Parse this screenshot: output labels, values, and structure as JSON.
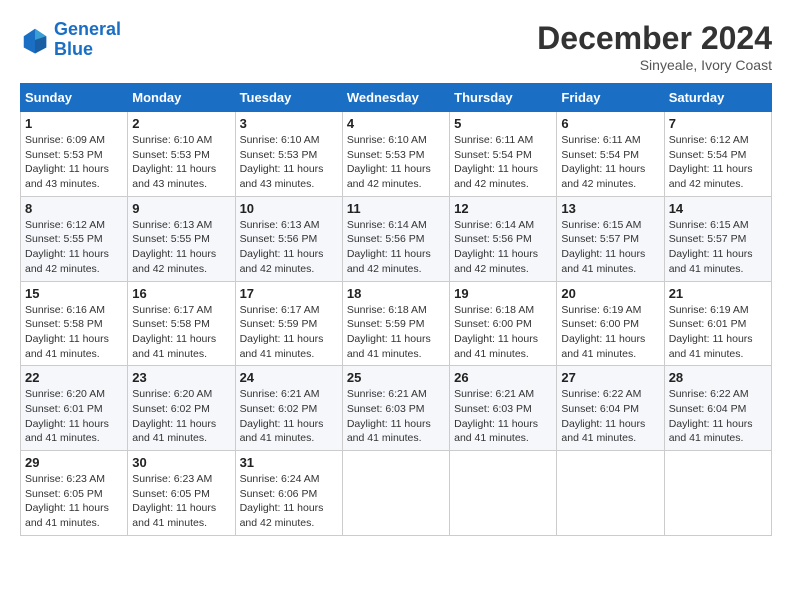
{
  "logo": {
    "line1": "General",
    "line2": "Blue"
  },
  "title": "December 2024",
  "subtitle": "Sinyeale, Ivory Coast",
  "weekdays": [
    "Sunday",
    "Monday",
    "Tuesday",
    "Wednesday",
    "Thursday",
    "Friday",
    "Saturday"
  ],
  "weeks": [
    [
      {
        "day": "1",
        "info": "Sunrise: 6:09 AM\nSunset: 5:53 PM\nDaylight: 11 hours and 43 minutes."
      },
      {
        "day": "2",
        "info": "Sunrise: 6:10 AM\nSunset: 5:53 PM\nDaylight: 11 hours and 43 minutes."
      },
      {
        "day": "3",
        "info": "Sunrise: 6:10 AM\nSunset: 5:53 PM\nDaylight: 11 hours and 43 minutes."
      },
      {
        "day": "4",
        "info": "Sunrise: 6:10 AM\nSunset: 5:53 PM\nDaylight: 11 hours and 42 minutes."
      },
      {
        "day": "5",
        "info": "Sunrise: 6:11 AM\nSunset: 5:54 PM\nDaylight: 11 hours and 42 minutes."
      },
      {
        "day": "6",
        "info": "Sunrise: 6:11 AM\nSunset: 5:54 PM\nDaylight: 11 hours and 42 minutes."
      },
      {
        "day": "7",
        "info": "Sunrise: 6:12 AM\nSunset: 5:54 PM\nDaylight: 11 hours and 42 minutes."
      }
    ],
    [
      {
        "day": "8",
        "info": "Sunrise: 6:12 AM\nSunset: 5:55 PM\nDaylight: 11 hours and 42 minutes."
      },
      {
        "day": "9",
        "info": "Sunrise: 6:13 AM\nSunset: 5:55 PM\nDaylight: 11 hours and 42 minutes."
      },
      {
        "day": "10",
        "info": "Sunrise: 6:13 AM\nSunset: 5:56 PM\nDaylight: 11 hours and 42 minutes."
      },
      {
        "day": "11",
        "info": "Sunrise: 6:14 AM\nSunset: 5:56 PM\nDaylight: 11 hours and 42 minutes."
      },
      {
        "day": "12",
        "info": "Sunrise: 6:14 AM\nSunset: 5:56 PM\nDaylight: 11 hours and 42 minutes."
      },
      {
        "day": "13",
        "info": "Sunrise: 6:15 AM\nSunset: 5:57 PM\nDaylight: 11 hours and 41 minutes."
      },
      {
        "day": "14",
        "info": "Sunrise: 6:15 AM\nSunset: 5:57 PM\nDaylight: 11 hours and 41 minutes."
      }
    ],
    [
      {
        "day": "15",
        "info": "Sunrise: 6:16 AM\nSunset: 5:58 PM\nDaylight: 11 hours and 41 minutes."
      },
      {
        "day": "16",
        "info": "Sunrise: 6:17 AM\nSunset: 5:58 PM\nDaylight: 11 hours and 41 minutes."
      },
      {
        "day": "17",
        "info": "Sunrise: 6:17 AM\nSunset: 5:59 PM\nDaylight: 11 hours and 41 minutes."
      },
      {
        "day": "18",
        "info": "Sunrise: 6:18 AM\nSunset: 5:59 PM\nDaylight: 11 hours and 41 minutes."
      },
      {
        "day": "19",
        "info": "Sunrise: 6:18 AM\nSunset: 6:00 PM\nDaylight: 11 hours and 41 minutes."
      },
      {
        "day": "20",
        "info": "Sunrise: 6:19 AM\nSunset: 6:00 PM\nDaylight: 11 hours and 41 minutes."
      },
      {
        "day": "21",
        "info": "Sunrise: 6:19 AM\nSunset: 6:01 PM\nDaylight: 11 hours and 41 minutes."
      }
    ],
    [
      {
        "day": "22",
        "info": "Sunrise: 6:20 AM\nSunset: 6:01 PM\nDaylight: 11 hours and 41 minutes."
      },
      {
        "day": "23",
        "info": "Sunrise: 6:20 AM\nSunset: 6:02 PM\nDaylight: 11 hours and 41 minutes."
      },
      {
        "day": "24",
        "info": "Sunrise: 6:21 AM\nSunset: 6:02 PM\nDaylight: 11 hours and 41 minutes."
      },
      {
        "day": "25",
        "info": "Sunrise: 6:21 AM\nSunset: 6:03 PM\nDaylight: 11 hours and 41 minutes."
      },
      {
        "day": "26",
        "info": "Sunrise: 6:21 AM\nSunset: 6:03 PM\nDaylight: 11 hours and 41 minutes."
      },
      {
        "day": "27",
        "info": "Sunrise: 6:22 AM\nSunset: 6:04 PM\nDaylight: 11 hours and 41 minutes."
      },
      {
        "day": "28",
        "info": "Sunrise: 6:22 AM\nSunset: 6:04 PM\nDaylight: 11 hours and 41 minutes."
      }
    ],
    [
      {
        "day": "29",
        "info": "Sunrise: 6:23 AM\nSunset: 6:05 PM\nDaylight: 11 hours and 41 minutes."
      },
      {
        "day": "30",
        "info": "Sunrise: 6:23 AM\nSunset: 6:05 PM\nDaylight: 11 hours and 41 minutes."
      },
      {
        "day": "31",
        "info": "Sunrise: 6:24 AM\nSunset: 6:06 PM\nDaylight: 11 hours and 42 minutes."
      },
      null,
      null,
      null,
      null
    ]
  ]
}
